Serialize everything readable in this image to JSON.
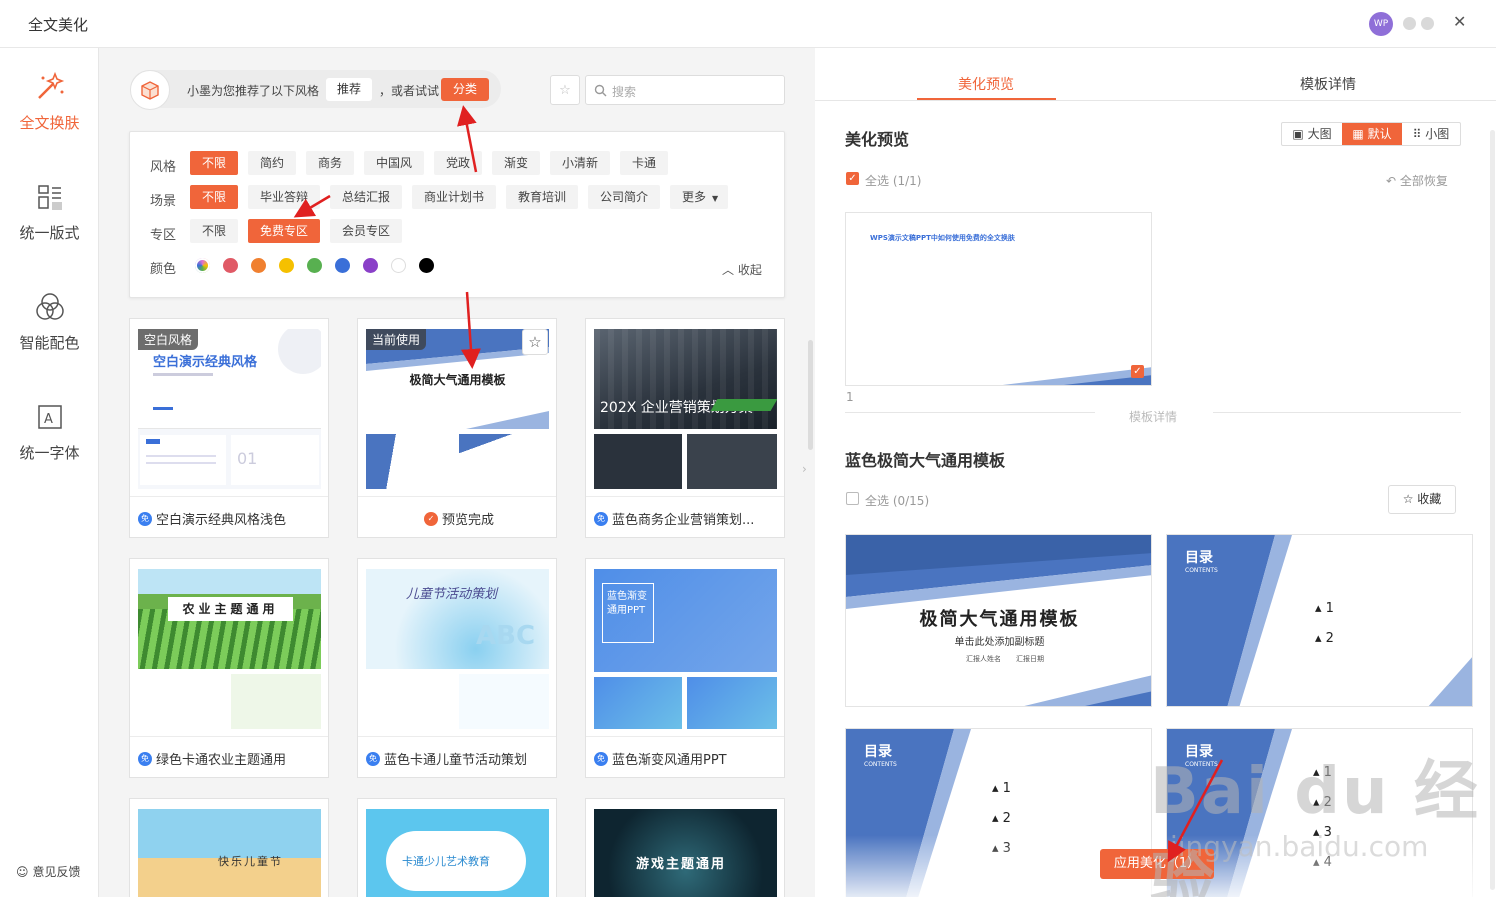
{
  "window": {
    "title": "全文美化",
    "avatar_text": "WP"
  },
  "sidebar": {
    "items": [
      {
        "label": "全文换肤",
        "icon": "magic-wand-icon",
        "active": true
      },
      {
        "label": "统一版式",
        "icon": "layout-icon",
        "active": false
      },
      {
        "label": "智能配色",
        "icon": "color-circles-icon",
        "active": false
      },
      {
        "label": "统一字体",
        "icon": "font-icon",
        "active": false
      }
    ],
    "feedback": "意见反馈"
  },
  "recommend": {
    "text1": "小墨为您推荐了以下风格",
    "recommend_btn": "推荐",
    "text2": "，或者试试",
    "category_btn": "分类",
    "search_placeholder": "搜索"
  },
  "filters": {
    "style": {
      "label": "风格",
      "options": [
        "不限",
        "简约",
        "商务",
        "中国风",
        "党政",
        "渐变",
        "小清新",
        "卡通"
      ],
      "selected": "不限"
    },
    "scene": {
      "label": "场景",
      "options": [
        "不限",
        "毕业答辩",
        "总结汇报",
        "商业计划书",
        "教育培训",
        "公司简介",
        "更多"
      ],
      "selected": "不限"
    },
    "zone": {
      "label": "专区",
      "options": [
        "不限",
        "免费专区",
        "会员专区"
      ],
      "selected": "免费专区"
    },
    "color": {
      "label": "颜色",
      "swatches": [
        "#e070d0",
        "#e05a66",
        "#f08030",
        "#f5c000",
        "#58b050",
        "#3a6fd8",
        "#8a40c8",
        "#ffffff",
        "#000000"
      ]
    },
    "collapse": "收起"
  },
  "templates": [
    {
      "tag": "空白风格",
      "title": "空白演示经典风格",
      "caption": "空白演示经典风格浅色"
    },
    {
      "tag": "当前使用",
      "title": "极简大气通用模板",
      "caption": "预览完成"
    },
    {
      "tag": "",
      "title": "202X 企业营销策划方案",
      "caption": "蓝色商务企业营销策划..."
    },
    {
      "tag": "",
      "title": "农业主题通用",
      "caption": "绿色卡通农业主题通用"
    },
    {
      "tag": "",
      "title": "儿童节活动策划",
      "caption": "蓝色卡通儿童节活动策划"
    },
    {
      "tag": "",
      "title": "蓝色渐变通用PPT",
      "caption": "蓝色渐变风通用PPT"
    },
    {
      "tag": "",
      "title": "快乐儿童节",
      "caption": ""
    },
    {
      "tag": "",
      "title": "卡通少儿艺术教育",
      "caption": ""
    },
    {
      "tag": "",
      "title": "游戏主题通用",
      "caption": ""
    }
  ],
  "right_panel": {
    "tabs": [
      "美化预览",
      "模板详情"
    ],
    "active_tab": "美化预览",
    "section_title": "美化预览",
    "view_modes": [
      "大图",
      "默认",
      "小图"
    ],
    "active_view": "默认",
    "select_all": "全选 (1/1)",
    "restore_all": "全部恢复",
    "preview_slide_title": "WPS演示文稿PPT中如何使用免费的全文换肤",
    "page_number": "1",
    "template_details_link": "模板详情",
    "template_name": "蓝色极简大气通用模板",
    "select_all_template": "全选 (0/15)",
    "favorite": "收藏",
    "slide_main_title": "极简大气通用模板",
    "slide_sub_title": "单击此处添加副标题",
    "slide_reporter": "汇报人姓名",
    "slide_date": "汇报日期",
    "toc_title": "目录",
    "toc_sub": "CONTENTS",
    "apply_button": "应用美化（1）"
  },
  "watermark": {
    "logo": "Bai du 经验",
    "url": "jingyan.baidu.com"
  },
  "colors": {
    "accent": "#f0653a",
    "blue": "#3a6fd8"
  }
}
